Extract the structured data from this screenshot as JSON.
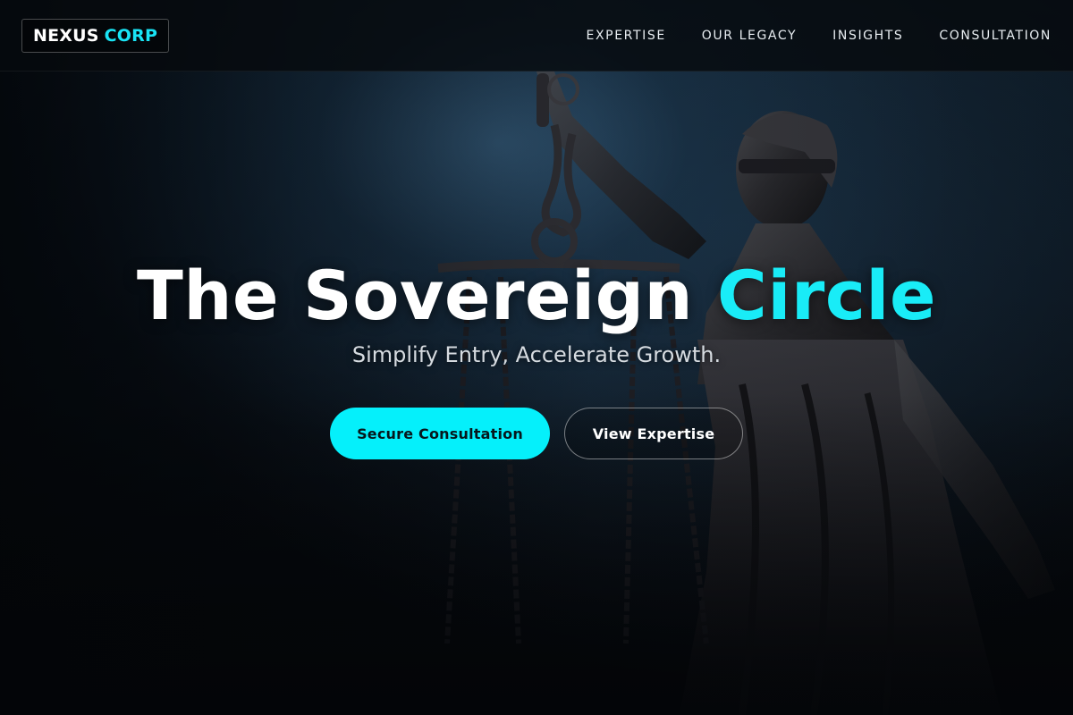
{
  "header": {
    "logo": {
      "word1": "NEXUS",
      "word2": "CORP"
    },
    "nav": [
      {
        "label": "EXPERTISE"
      },
      {
        "label": "OUR LEGACY"
      },
      {
        "label": "INSIGHTS"
      },
      {
        "label": "CONSULTATION"
      }
    ]
  },
  "hero": {
    "title_main": "The Sovereign",
    "title_accent": "Circle",
    "subtitle": "Simplify Entry, Accelerate Growth.",
    "primary_cta": "Secure Consultation",
    "secondary_cta": "View Expertise",
    "background_image": "justice-statue-scales"
  },
  "colors": {
    "accent": "#19ECF7",
    "button_primary": "#05F0FB",
    "background": "#06080B"
  }
}
